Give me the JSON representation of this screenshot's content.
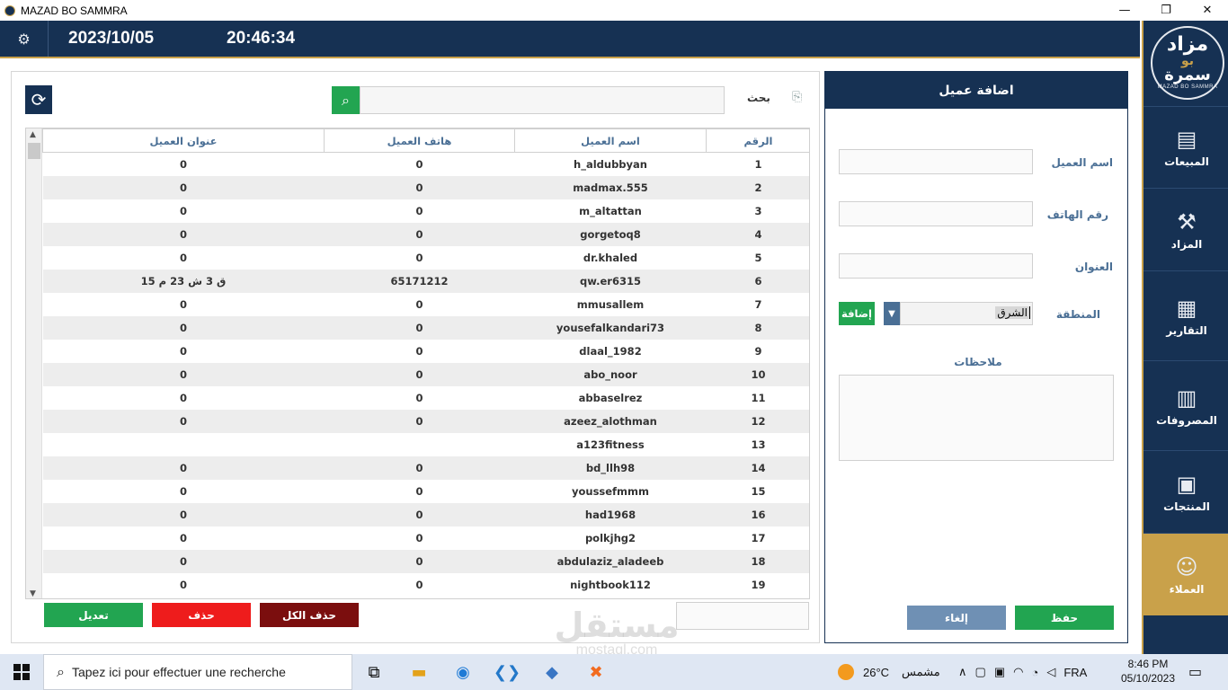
{
  "window": {
    "title": "MAZAD BO SAMMRA",
    "minimize": "—",
    "maximize": "❐",
    "close": "✕"
  },
  "header": {
    "date": "2023/10/05",
    "time": "20:46:34"
  },
  "sidebar": {
    "logo": {
      "line1": "مزاد",
      "line2": "بو",
      "line3": "سمرة",
      "line4": "MAZAD BO SAMMRA"
    },
    "items": [
      {
        "label": "المبيعات",
        "icon": "cash-register-icon"
      },
      {
        "label": "المزاد",
        "icon": "gavel-icon"
      },
      {
        "label": "التقارير",
        "icon": "reports-icon"
      },
      {
        "label": "المصروفات",
        "icon": "expenses-icon"
      },
      {
        "label": "المنتجات",
        "icon": "box-icon"
      },
      {
        "label": "العملاء",
        "icon": "users-icon",
        "active": true
      }
    ]
  },
  "search": {
    "label": "بحث",
    "value": ""
  },
  "table": {
    "headers": {
      "id": "الرقم",
      "name": "اسم العميل",
      "phone": "هاتف العميل",
      "address": "عنوان العميل"
    },
    "rows": [
      {
        "id": "1",
        "name": "h_aldubbyan",
        "phone": "0",
        "address": "0"
      },
      {
        "id": "2",
        "name": "madmax.555",
        "phone": "0",
        "address": "0"
      },
      {
        "id": "3",
        "name": "m_altattan",
        "phone": "0",
        "address": "0"
      },
      {
        "id": "4",
        "name": "gorgetoq8",
        "phone": "0",
        "address": "0"
      },
      {
        "id": "5",
        "name": "dr.khaled",
        "phone": "0",
        "address": "0"
      },
      {
        "id": "6",
        "name": "qw.er6315",
        "phone": "65171212",
        "address": "ق 3 ش 23 م 15"
      },
      {
        "id": "7",
        "name": "mmusallem",
        "phone": "0",
        "address": "0"
      },
      {
        "id": "8",
        "name": "yousefalkandari73",
        "phone": "0",
        "address": "0"
      },
      {
        "id": "9",
        "name": "dlaal_1982",
        "phone": "0",
        "address": "0"
      },
      {
        "id": "10",
        "name": "abo_noor",
        "phone": "0",
        "address": "0"
      },
      {
        "id": "11",
        "name": "abbaselrez",
        "phone": "0",
        "address": "0"
      },
      {
        "id": "12",
        "name": "azeez_alothman",
        "phone": "0",
        "address": "0"
      },
      {
        "id": "13",
        "name": "a123fitness",
        "phone": "",
        "address": ""
      },
      {
        "id": "14",
        "name": "bd_llh98",
        "phone": "0",
        "address": "0"
      },
      {
        "id": "15",
        "name": "youssefmmm",
        "phone": "0",
        "address": "0"
      },
      {
        "id": "16",
        "name": "had1968",
        "phone": "0",
        "address": "0"
      },
      {
        "id": "17",
        "name": "polkjhg2",
        "phone": "0",
        "address": "0"
      },
      {
        "id": "18",
        "name": "abdulaziz_aladeeb",
        "phone": "0",
        "address": "0"
      },
      {
        "id": "19",
        "name": "nightbook112",
        "phone": "0",
        "address": "0"
      }
    ]
  },
  "actions": {
    "edit": "تعديل",
    "delete": "حذف",
    "delete_all": "حذف الكل"
  },
  "form": {
    "title": "اضافة عميل",
    "name_label": "اسم العميل",
    "phone_label": "رقم الهاتف",
    "address_label": "العنوان",
    "region_label": "المنطقة",
    "region_value": "الشرق",
    "add_region": "إضافة",
    "notes_label": "ملاحظات",
    "cancel": "إلغاء",
    "save": "حفظ"
  },
  "watermark": {
    "line1": "مستقل",
    "line2": "mostaql.com"
  },
  "taskbar": {
    "search_placeholder": "Tapez ici pour effectuer une recherche",
    "weather_temp": "26°C",
    "weather_text": "مشمس",
    "language": "FRA",
    "clock_time": "8:46 PM",
    "clock_date": "05/10/2023"
  },
  "colors": {
    "navy": "#163153",
    "gold": "#c9a14a",
    "green": "#22a551",
    "red": "#ee1c1c",
    "dark_red": "#7b0e0e",
    "steel_blue": "#6f90b4"
  }
}
